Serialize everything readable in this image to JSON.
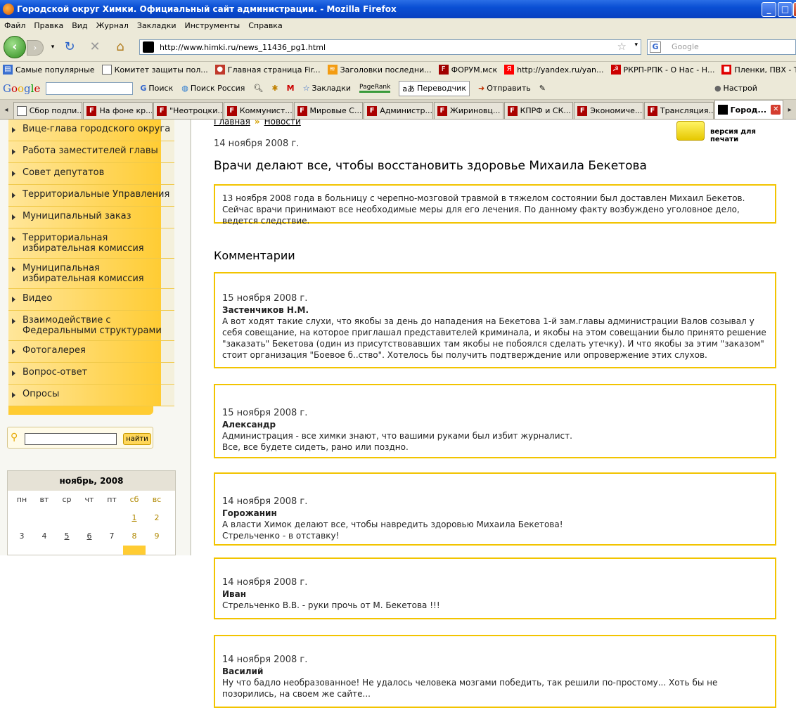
{
  "window": {
    "title": "Городской округ Химки. Официальный сайт администрации. - Mozilla Firefox",
    "controls": [
      "_",
      "□",
      "✕"
    ]
  },
  "menu": [
    "Файл",
    "Правка",
    "Вид",
    "Журнал",
    "Закладки",
    "Инструменты",
    "Справка"
  ],
  "nav": {
    "url": "http://www.himki.ru/news_11436_pg1.html",
    "search_placeholder": "Google"
  },
  "bookmarks": [
    {
      "label": "Самые популярные",
      "color": "#3a6fd0",
      "glyph": "▤"
    },
    {
      "label": "Комитет защиты пол...",
      "color": "#ffffff",
      "glyph": ""
    },
    {
      "label": "Главная страница Fir...",
      "color": "#c0392b",
      "glyph": "●"
    },
    {
      "label": "Заголовки последни...",
      "color": "#f39c12",
      "glyph": "≋"
    },
    {
      "label": "ФОРУМ.мск",
      "color": "#a00000",
      "glyph": "F"
    },
    {
      "label": "http://yandex.ru/yan...",
      "color": "#ff0000",
      "glyph": "Я"
    },
    {
      "label": "РКРП-РПК - О Нас - Н...",
      "color": "#cc0000",
      "glyph": "☭"
    },
    {
      "label": "Пленки, ПВХ - Тести...",
      "color": "#e00000",
      "glyph": "■"
    }
  ],
  "googlebar": {
    "logo": "Google",
    "items": [
      "Поиск",
      "Поиск Россия",
      "Закладки",
      "PageRank",
      "Переводчик",
      "Отправить",
      "Настрой"
    ]
  },
  "tabs": [
    {
      "label": "Сбор подпи...",
      "icon": "page",
      "active": false
    },
    {
      "label": "На фоне кр...",
      "icon": "F",
      "active": false
    },
    {
      "label": "\"Неотроцки...",
      "icon": "F",
      "active": false
    },
    {
      "label": "Коммунист...",
      "icon": "F",
      "active": false
    },
    {
      "label": "Мировые С...",
      "icon": "F",
      "active": false
    },
    {
      "label": "Администр...",
      "icon": "F",
      "active": false
    },
    {
      "label": "Жириновц...",
      "icon": "F",
      "active": false
    },
    {
      "label": "КПРФ и СК...",
      "icon": "F",
      "active": false
    },
    {
      "label": "Экономиче...",
      "icon": "F",
      "active": false
    },
    {
      "label": "Трансляция...",
      "icon": "F",
      "active": false
    },
    {
      "label": "Город...",
      "icon": "site",
      "active": true
    }
  ],
  "sidebar": {
    "items": [
      "Вице-глава городского округа",
      "Работа заместителей главы",
      "Совет депутатов",
      "Территориальные Управления",
      "Муниципальный заказ",
      "Территориальная избирательная комиссия",
      "Муниципальная избирательная комиссия",
      "Видео",
      "Взаимодействие с Федеральными структурами",
      "Фотогалерея",
      "Вопрос-ответ",
      "Опросы"
    ],
    "search_button": "найти"
  },
  "calendar": {
    "title": "ноябрь, 2008",
    "weekdays": [
      "пн",
      "вт",
      "ср",
      "чт",
      "пт",
      "сб",
      "вс"
    ],
    "days": [
      [
        "",
        "",
        "",
        "",
        "",
        "1",
        "2"
      ],
      [
        "3",
        "4",
        "5",
        "6",
        "7",
        "8",
        "9"
      ]
    ],
    "linked_days": [
      "1",
      "5",
      "6"
    ]
  },
  "breadcrumb": {
    "home": "Главная",
    "separator": "»",
    "section": "Новости"
  },
  "print_label": "версия для печати",
  "news": {
    "date": "14 ноября 2008 г.",
    "title": "Врачи делают все, чтобы восстановить здоровье Михаила Бекетова",
    "body": "13 ноября 2008 года в больницу с черепно-мозговой травмой в тяжелом состоянии был доставлен Михаил Бекетов. Сейчас врачи принимают все необходимые меры для его лечения. По данному факту возбуждено уголовное дело, ведется следствие."
  },
  "comments_heading": "Комментарии",
  "comments": [
    {
      "date": "15 ноября 2008 г.",
      "author": "Застенчиков Н.М.",
      "lines": [
        "А вот ходят такие слухи, что якобы за день до нападения на Бекетова 1-й зам.главы администрации Валов созывал у себя совещание, на которое приглашал представителей криминала, и якобы на этом совещании было принято решение \"заказать\" Бекетова (один из присутствовавших там якобы не побоялся сделать утечку). И что якобы за этим \"заказом\" стоит организация \"Боевое б..ство\". Хотелось бы получить подтверждение или опровержение этих слухов."
      ]
    },
    {
      "date": "15 ноября 2008 г.",
      "author": "Александр",
      "lines": [
        "Администрация - все химки знают, что вашими руками был избит журналист.",
        "Все, все будете сидеть, рано или поздно."
      ]
    },
    {
      "date": "14 ноября 2008 г.",
      "author": "Горожанин",
      "lines": [
        "А власти Химок делают все, чтобы навредить здоровью Михаила Бекетова!",
        "Стрельченко - в отставку!"
      ]
    },
    {
      "date": "14 ноября 2008 г.",
      "author": "Иван",
      "lines": [
        "Стрельченко В.В. - руки прочь от М. Бекетова !!!"
      ]
    },
    {
      "date": "14 ноября 2008 г.",
      "author": "Василий",
      "lines": [
        "Ну что бадло необразованное! Не удалось человека мозгами победить, так решили по-простому... Хоть бы не позорились, на своем же сайте..."
      ]
    }
  ],
  "colors": {
    "accent": "#f2c400",
    "menu": "#ffcc33",
    "titlebar": "#0a4fd4"
  }
}
